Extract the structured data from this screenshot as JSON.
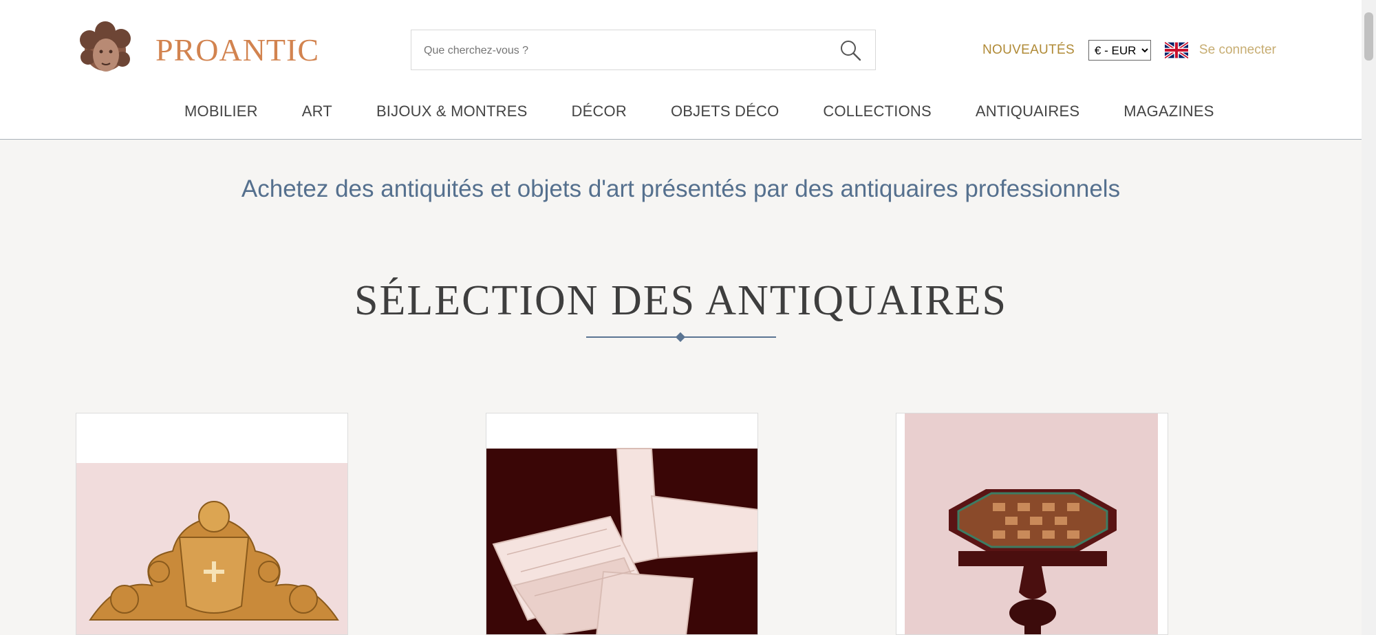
{
  "header": {
    "logo_text": "PROANTIC",
    "search": {
      "placeholder": "Que cherchez-vous ?"
    },
    "nouveautes": "NOUVEAUTÉS",
    "currency": "€ - EUR",
    "language_flag": "uk-flag-icon",
    "login": "Se connecter"
  },
  "nav": {
    "items": [
      "MOBILIER",
      "ART",
      "BIJOUX & MONTRES",
      "DÉCOR",
      "OBJETS DÉCO",
      "COLLECTIONS",
      "ANTIQUAIRES",
      "MAGAZINES"
    ]
  },
  "main": {
    "tagline": "Achetez des antiquités et objets d'art présentés par des antiquaires professionnels",
    "section_title": "SÉLECTION DES ANTIQUAIRES"
  },
  "colors": {
    "logo": "#d2834f",
    "nouveautes": "#b08a36",
    "login": "#c7ad72",
    "tagline": "#55708e",
    "background": "#f6f5f3"
  }
}
